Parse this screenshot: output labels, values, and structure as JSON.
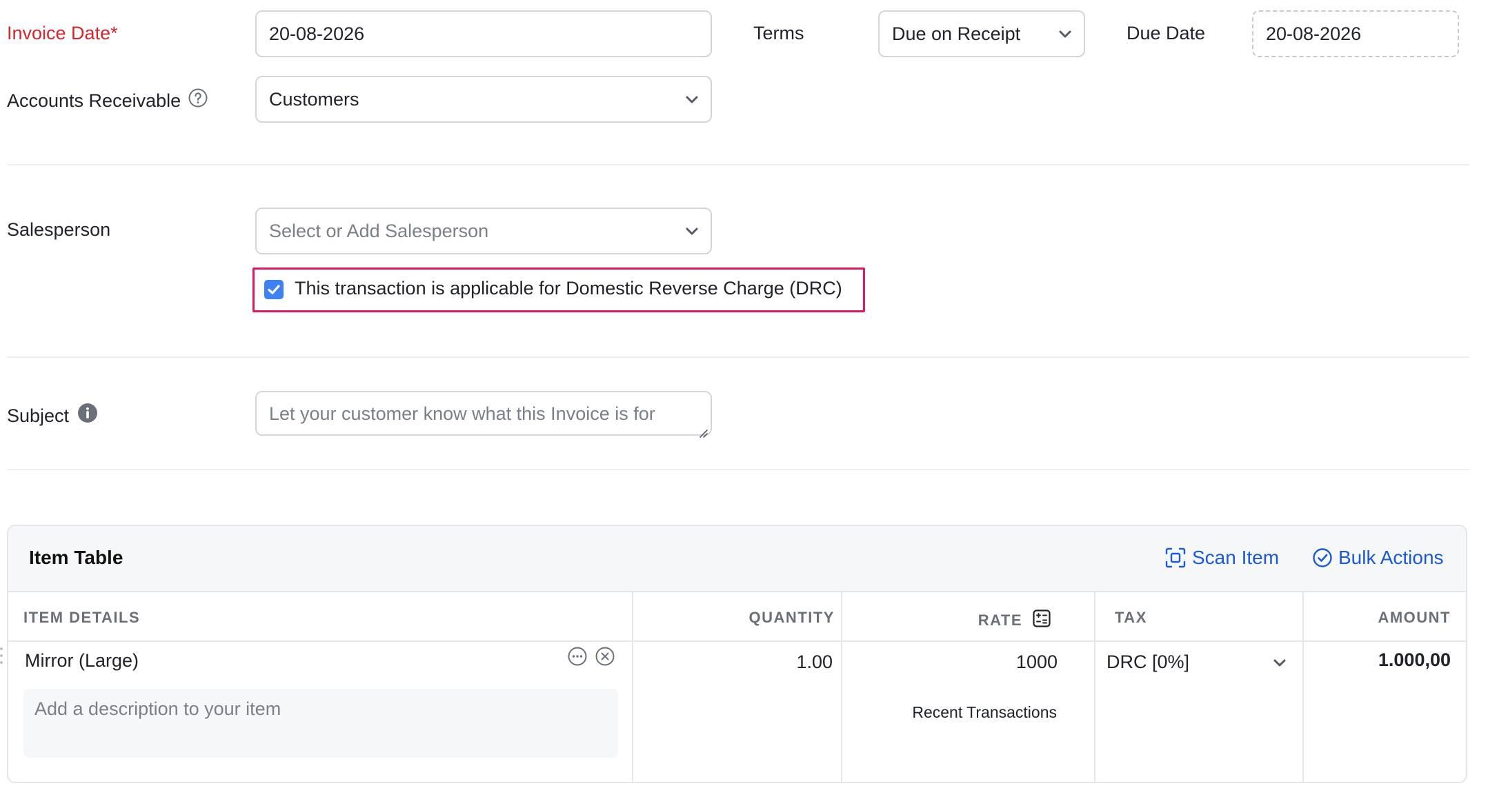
{
  "form": {
    "invoice_date_label": "Invoice Date*",
    "invoice_date_value": "20-08-2026",
    "terms_label": "Terms",
    "terms_value": "Due on Receipt",
    "due_date_label": "Due Date",
    "due_date_value": "20-08-2026",
    "accounts_receivable_label": "Accounts Receivable",
    "accounts_receivable_value": "Customers",
    "salesperson_label": "Salesperson",
    "salesperson_placeholder": "Select or Add Salesperson",
    "drc_checkbox_label": "This transaction is applicable for Domestic Reverse Charge (DRC)",
    "drc_checked": true,
    "subject_label": "Subject",
    "subject_placeholder": "Let your customer know what this Invoice is for"
  },
  "item_table": {
    "title": "Item Table",
    "scan_item_label": "Scan Item",
    "bulk_actions_label": "Bulk Actions",
    "columns": {
      "item_details": "ITEM DETAILS",
      "quantity": "QUANTITY",
      "rate": "RATE",
      "tax": "TAX",
      "amount": "AMOUNT"
    },
    "rows": [
      {
        "item": "Mirror (Large)",
        "description_placeholder": "Add a description to your item",
        "quantity": "1.00",
        "rate": "1000",
        "recent_transactions_label": "Recent Transactions",
        "tax": "DRC [0%]",
        "amount": "1.000,00"
      }
    ]
  },
  "colors": {
    "required": "#d6262c",
    "accent_blue": "#1a5ad7",
    "checkbox": "#3d82f0",
    "highlight_border": "#e0195f"
  }
}
